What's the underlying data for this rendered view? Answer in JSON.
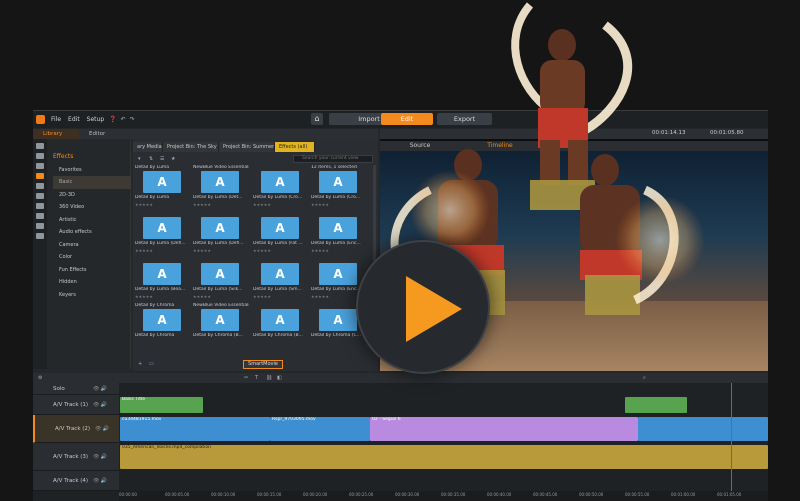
{
  "menubar": {
    "items": [
      "File",
      "Edit",
      "Setup"
    ],
    "home_icon": "home-icon",
    "nav": [
      "Import",
      "Edit",
      "Export"
    ],
    "active_nav": "Edit"
  },
  "library_bar": {
    "tabs": [
      "Library",
      "Editor"
    ],
    "active": "Library"
  },
  "sidebar": {
    "heading": "Effects",
    "items": [
      "Favorites",
      "Basic",
      "2D-3D",
      "360 Video",
      "Artistic",
      "Audio effects",
      "Camera",
      "Color",
      "Fun Effects",
      "Hidden",
      "Keyers"
    ],
    "selected": "Basic"
  },
  "content": {
    "tabs": [
      "ary Media",
      "Project Bin: The Sky is...",
      "Project Bin: Summer H...",
      "Effects (all)"
    ],
    "active_tab": "Effects (all)",
    "search_placeholder": "Search your current view",
    "count_label": "12 items, 1 selected",
    "rows": [
      {
        "header": [
          "Detail by Luma",
          "NewBlue Video Essentials VII",
          "",
          "12 items, 1 selected"
        ],
        "captions": [
          "Detail by Luma",
          "Detail by Luma (Det...",
          "Detail by Luma (Cro...",
          "Detail by Luma (Cro..."
        ]
      },
      {
        "header": [],
        "captions": [
          "Detail by Luma (Defi...",
          "Detail by Luma (Defi...",
          "Detail by Luma (Fat ...",
          "Detail by Luma (Enc..."
        ]
      },
      {
        "header": [],
        "captions": [
          "Detail by Luma (Bea...",
          "Detail by Luma (Silk...",
          "Detail by Luma (Sm...",
          "Detail by Luma (Enc..."
        ]
      },
      {
        "header": [
          "Detail by Chroma",
          "NewBlue Video Essentials VII",
          "",
          ""
        ],
        "captions": [
          "Detail by Chroma",
          "Detail by Chroma (B...",
          "Detail by Chroma (B...",
          "Detail by Chroma (C..."
        ]
      }
    ],
    "thumb_glyph": "A",
    "stars": "★★★★★",
    "smart_button": "SmartMovie"
  },
  "preview": {
    "tabs": [
      "Source",
      "Timeline"
    ],
    "active_tab": "Timeline",
    "timecode_left": "00:01:14.13",
    "timecode_right": "00:01:05.80"
  },
  "timeline": {
    "tracks": [
      {
        "name": "Solo"
      },
      {
        "name": "A/V Track (1)"
      },
      {
        "name": "A/V Track (2)"
      },
      {
        "name": "A/V Track (3)"
      },
      {
        "name": "A/V Track (4)"
      }
    ],
    "selected_track": "A/V Track (2)",
    "clips": {
      "title_clip": "Basic Title",
      "video_clip_1": "cu34481915.mov",
      "video_clip_2": "Rspr_9703095.mov",
      "video_clip_3": "02 - Segue 6",
      "audio_clip": "035_American_Voices.mp4_compilation"
    },
    "ruler": [
      "00:00:00",
      "00:00:05.00",
      "00:00:10.00",
      "00:00:15.00",
      "00:00:20.00",
      "00:00:25.00",
      "00:00:30.00",
      "00:00:35.00",
      "00:00:40.00",
      "00:00:45.00",
      "00:00:50.00",
      "00:00:55.00",
      "00:01:00.00",
      "00:01:05.00",
      "00:01:10.00"
    ]
  },
  "overlay": {
    "play_icon": "play-icon"
  },
  "colors": {
    "accent": "#f28a1e",
    "thumb": "#4aa2dd",
    "audio": "#b89a3a",
    "video_blue": "#3d8fd1",
    "video_violet": "#b98be0",
    "title_green": "#57a34f"
  }
}
